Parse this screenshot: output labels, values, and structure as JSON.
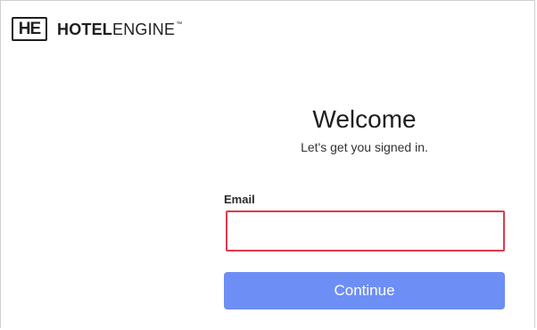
{
  "brand": {
    "mark": "HE",
    "name_bold": "HOTEL",
    "name_light": "ENGINE",
    "trademark": "™"
  },
  "login": {
    "title": "Welcome",
    "subtitle": "Let's get you signed in.",
    "email_label": "Email",
    "email_value": "",
    "continue_label": "Continue"
  },
  "colors": {
    "button": "#6d8ef4",
    "input_highlight_border": "#e03a4a"
  }
}
